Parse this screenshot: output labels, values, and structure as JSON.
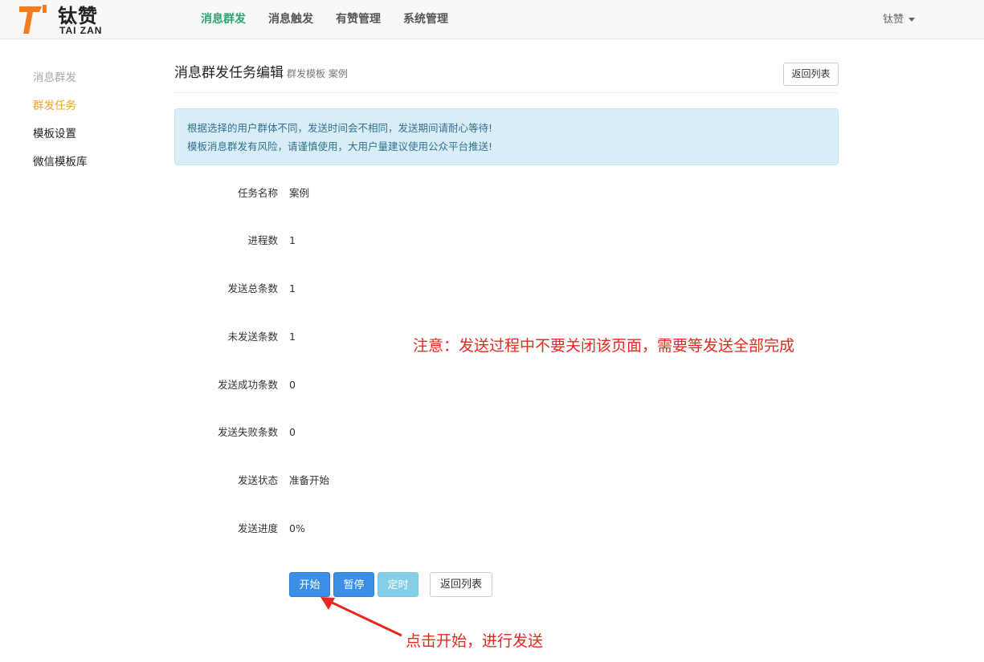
{
  "brand": {
    "cn": "钛赞",
    "en": "TAI ZAN",
    "accent": "#f07d1e"
  },
  "nav": {
    "items": [
      {
        "label": "消息群发",
        "active": true
      },
      {
        "label": "消息触发"
      },
      {
        "label": "有赞管理"
      },
      {
        "label": "系统管理"
      }
    ],
    "user": "钛赞"
  },
  "sidebar": {
    "heading": "消息群发",
    "items": [
      {
        "label": "群发任务",
        "active": true
      },
      {
        "label": "模板设置"
      },
      {
        "label": "微信模板库"
      }
    ]
  },
  "page": {
    "title": "消息群发任务编辑",
    "subtitle": "群发模板 案例",
    "back_label": "返回列表"
  },
  "alert": {
    "line1": "根据选择的用户群体不同，发送时间会不相同，发送期间请耐心等待!",
    "line2": "模板消息群发有风险，请谨慎使用，大用户量建议使用公众平台推送!"
  },
  "fields": [
    {
      "label": "任务名称",
      "value": "案例"
    },
    {
      "label": "进程数",
      "value": "1"
    },
    {
      "label": "发送总条数",
      "value": "1"
    },
    {
      "label": "未发送条数",
      "value": "1"
    },
    {
      "label": "发送成功条数",
      "value": "0"
    },
    {
      "label": "发送失败条数",
      "value": "0"
    },
    {
      "label": "发送状态",
      "value": "准备开始"
    },
    {
      "label": "发送进度",
      "value": "0%"
    }
  ],
  "actions": {
    "start": "开始",
    "pause": "暂停",
    "schedule": "定时",
    "back": "返回列表"
  },
  "annotations": {
    "note": "注意：发送过程中不要关闭该页面，需要等发送全部完成",
    "hint": "点击开始，进行发送"
  }
}
